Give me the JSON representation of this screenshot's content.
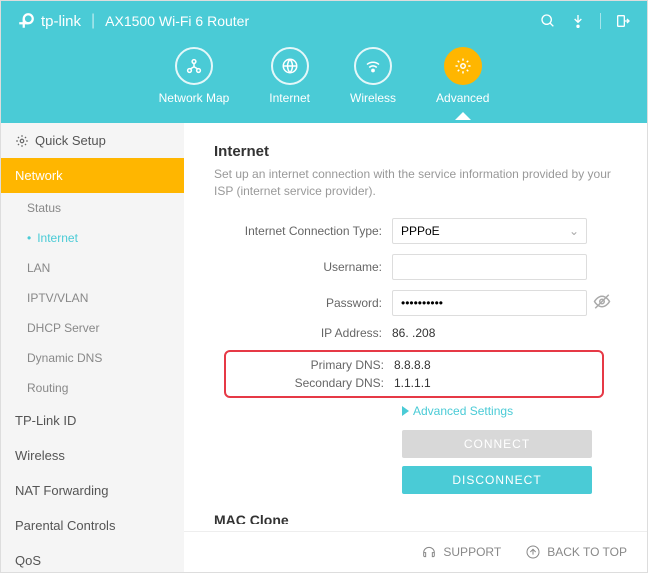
{
  "header": {
    "brand": "tp-link",
    "product": "AX1500 Wi-Fi 6 Router"
  },
  "nav": {
    "network_map": "Network Map",
    "internet": "Internet",
    "wireless": "Wireless",
    "advanced": "Advanced"
  },
  "sidebar": {
    "quick_setup": "Quick Setup",
    "network": "Network",
    "sub": {
      "status": "Status",
      "internet": "Internet",
      "lan": "LAN",
      "iptv_vlan": "IPTV/VLAN",
      "dhcp_server": "DHCP Server",
      "dynamic_dns": "Dynamic DNS",
      "routing": "Routing"
    },
    "tplink_id": "TP-Link ID",
    "wireless": "Wireless",
    "nat_forwarding": "NAT Forwarding",
    "parental_controls": "Parental Controls",
    "qos": "QoS"
  },
  "content": {
    "title": "Internet",
    "desc": "Set up an internet connection with the service information provided by your ISP (internet service provider).",
    "labels": {
      "conn_type": "Internet Connection Type:",
      "username": "Username:",
      "password": "Password:",
      "ip_address": "IP Address:",
      "primary_dns": "Primary DNS:",
      "secondary_dns": "Secondary DNS:"
    },
    "values": {
      "conn_type": "PPPoE",
      "username": "",
      "password": "••••••••••",
      "ip_address": "86.         .208",
      "primary_dns": "8.8.8.8",
      "secondary_dns": "1.1.1.1"
    },
    "advanced_link": "Advanced Settings",
    "buttons": {
      "connect": "CONNECT",
      "disconnect": "DISCONNECT"
    },
    "mac_clone": "MAC Clone"
  },
  "footer": {
    "support": "SUPPORT",
    "back_to_top": "BACK TO TOP"
  }
}
